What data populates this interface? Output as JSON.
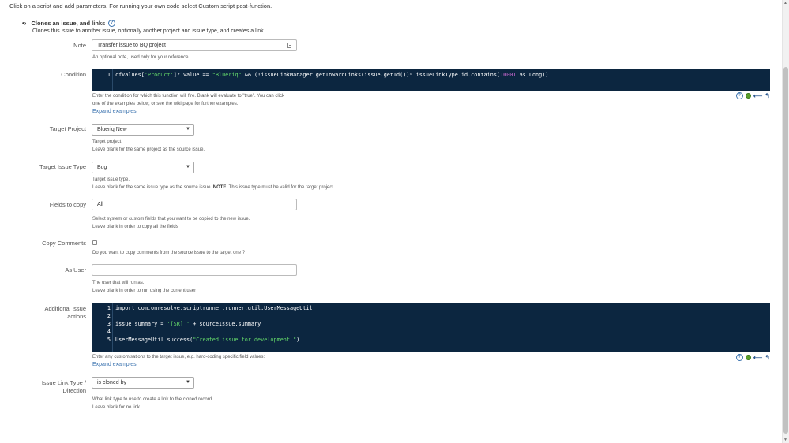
{
  "top_note": "Click on a script and add parameters. For running your own code select Custom script post-function.",
  "section": {
    "title": "Clones an issue, and links",
    "help_icon": "?",
    "description": "Clones this issue to another issue, optionally another project and issue type, and creates a link."
  },
  "note": {
    "label": "Note",
    "value": "Transfer issue to BQ project",
    "hint": "An optional note, used only for your reference."
  },
  "condition": {
    "label": "Condition",
    "line_number": "1",
    "code": {
      "p1": "cfValues[",
      "s1": "'Product'",
      "p2": "]?.value == ",
      "s2": "\"Blueriq\"",
      "p3": " && (!issueLinkManager.getInwardLinks(issue.getId())*.issueLinkType.id.contains(",
      "n1": "10001",
      "p4": " as Long))"
    },
    "hint_line1": "Enter the condition for which this function will fire. Blank will evaluate to \"true\". You can click",
    "hint_line2": "one of the examples below, or see the wiki page for further examples.",
    "expand_label": "Expand examples"
  },
  "target_project": {
    "label": "Target Project",
    "value": "Blueriq New",
    "hint_line1": "Target project.",
    "hint_line2": "Leave blank for the same project as the source issue."
  },
  "target_issue_type": {
    "label": "Target Issue Type",
    "value": "Bug",
    "hint_line1": "Target issue type.",
    "hint_line2_pre": "Leave blank for the same issue type as the source issue. ",
    "hint_line2_bold": "NOTE",
    "hint_line2_post": ": This issue type must be valid for the target project."
  },
  "fields_to_copy": {
    "label": "Fields to copy",
    "value": "All",
    "hint_line1": "Select system or custom fields that you want to be copied to the new issue.",
    "hint_line2": "Leave blank in order to copy all the fields"
  },
  "copy_comments": {
    "label": "Copy Comments",
    "checked": false,
    "hint": "Do you want to copy comments from the source issue to the target one ?"
  },
  "as_user": {
    "label": "As User",
    "value": "",
    "hint_line1": "The user that will run as.",
    "hint_line2": "Leave blank in order to run using the current user"
  },
  "additional_actions": {
    "label_line1": "Additional issue",
    "label_line2": "actions",
    "lines": [
      {
        "n": "1",
        "a": "import com.onresolve.scriptrunner.runner.util.UserMessageUtil"
      },
      {
        "n": "2",
        "a": ""
      },
      {
        "n": "3",
        "a": "issue.summary = ",
        "s": "'[SR] '",
        "b": " + sourceIssue.summary"
      },
      {
        "n": "4",
        "a": ""
      },
      {
        "n": "5",
        "a": "UserMessageUtil.success(",
        "s": "\"Created issue for development.\"",
        "b": ")"
      }
    ],
    "hint": "Enter any customisations to the target issue, e.g. hard-coding specific field values:",
    "expand_label": "Expand examples"
  },
  "link_type": {
    "label_line1": "Issue Link Type /",
    "label_line2": "Direction",
    "value": "is cloned by",
    "hint_line1": "What link type to use to create a link to the cloned record.",
    "hint_line2": "Leave blank for no link."
  },
  "toolbar": {
    "help_icon": "?"
  },
  "icons": {
    "bullet": "arrow-bullet-icon",
    "help": "help-icon",
    "ok": "syntax-ok-icon",
    "undo": "undo-icon",
    "redo": "redo-icon",
    "doc": "document-icon"
  },
  "colors": {
    "editor_bg": "#0c2640",
    "string": "#64d86a",
    "number": "#d36ad6",
    "link": "#3b73af"
  }
}
